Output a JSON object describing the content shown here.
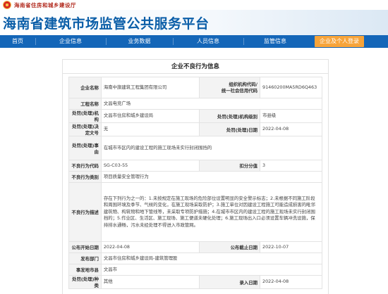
{
  "header": {
    "department": "海南省住房和城乡建设厅",
    "site_title": "海南省建筑市场监管公共服务平台"
  },
  "nav": {
    "items": [
      "首页",
      "企业信息",
      "业务数据",
      "人员信息",
      "监管信息"
    ],
    "cta_label": "企业及个人登录"
  },
  "record": {
    "title": "企业不良行为信息",
    "labels": {
      "company_name": "企业名称",
      "org_code": "组织机构代码/\n统一社会信用代码",
      "project_name": "工程名称",
      "penalty_dept": "处罚(处理)机构",
      "dept_level": "处罚(处理)机构级别",
      "penalty_doc": "处罚(处理)决定文号",
      "penalty_date": "处罚(处理)日期",
      "penalty_reason": "处罚(处理)事由",
      "behavior_code": "不良行为代码",
      "deduct_points": "扣分分值",
      "behavior_category": "不良行为类别",
      "behavior_desc": "不良行为描述",
      "publish_date": "公布开始日期",
      "publish_end_date": "公布截止日期",
      "publish_dept": "发布部门",
      "city": "事发地市县",
      "penalty_type": "处罚(处理)种类",
      "entry_date": "录入日期"
    },
    "company_name": "海南中旗建筑工程集团有限公司",
    "org_code": "91460200MA5RD6Q463",
    "project_name": "文昌电竞广场",
    "penalty_dept": "文昌市住房和城乡建设局",
    "dept_level": "市县级",
    "penalty_doc": "无",
    "penalty_date": "2022-04-08",
    "penalty_reason": "在城市市区内的建设工程的施工现场未实行封闭围挡的",
    "behavior_code": "SG-C03-55",
    "deduct_points": "3",
    "behavior_category": "项目质量安全管理行为",
    "behavior_desc": "存在下列行为之一的：1.未按规定在施工现场的危险部位设置明显的安全警示标志；2.未根据不同施工阶段和周围环境及季节、气候的变化，在施工现场采取防护；3.施工单位对因建设工程施工可能造成损害的毗邻建筑物、构筑物和地下管线等，未采取专项防护措施；4.在城市市区内的建设工程的施工现场未实行封闭围挡的；5.作业区、生活区、施工现场、施工便道未硬化处理；6.施工现场出入口必须设置车辆冲洗设施，保持排水通畅，污水未经处理不得进入市政管网。",
    "publish_date": "2022-04-08",
    "publish_end_date": "2022-10-07",
    "publish_dept": "文昌市住房和城乡建设局-建筑管理股",
    "city": "文昌市",
    "penalty_type": "其他",
    "entry_date": "2022-04-08"
  }
}
